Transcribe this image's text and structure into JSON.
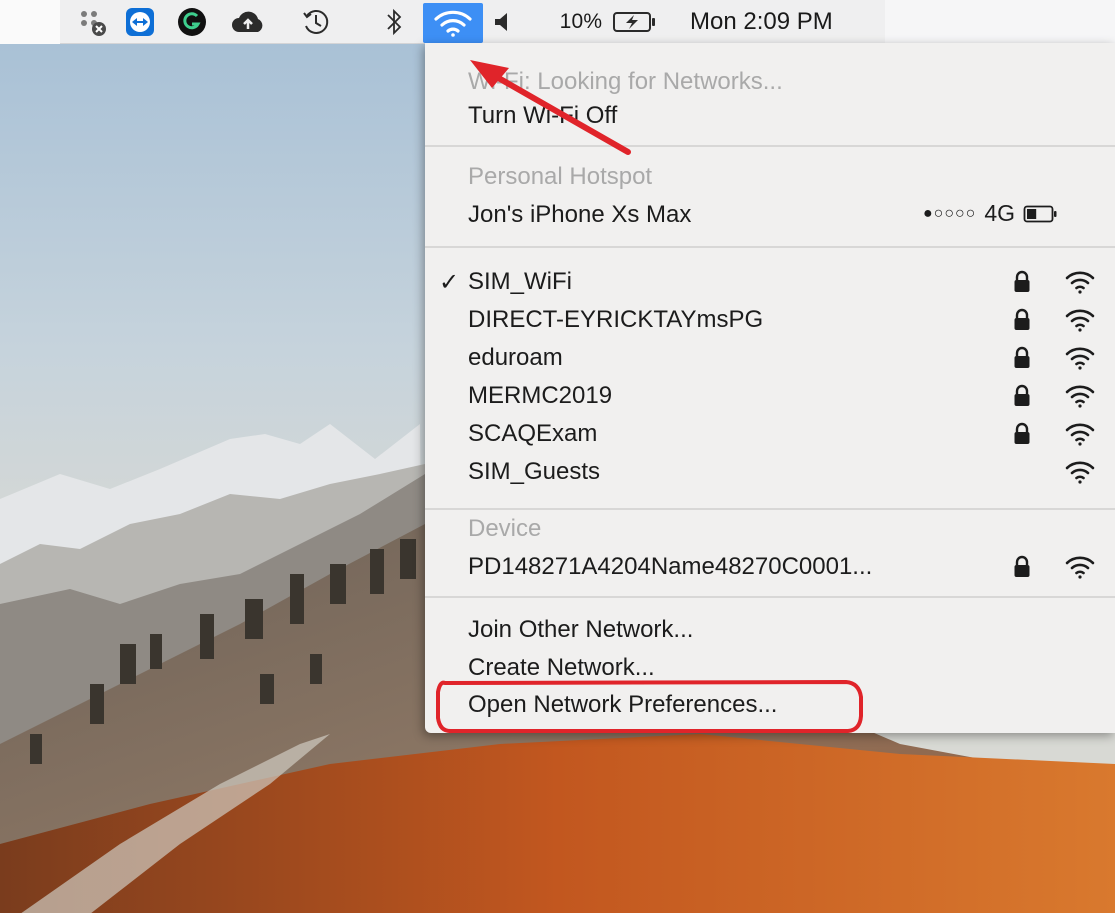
{
  "menubar": {
    "battery_percent": "10%",
    "clock": "Mon 2:09 PM",
    "icons": [
      "extension-icon",
      "teamviewer-icon",
      "grammarly-icon",
      "cloud-upload-icon",
      "time-machine-icon",
      "bluetooth-icon",
      "wifi-icon",
      "volume-icon",
      "battery-charging-icon"
    ],
    "battery_level": 0.1,
    "accent_color": "#3d8ff5"
  },
  "wifi_menu": {
    "status": "Wi-Fi: Looking for Networks...",
    "toggle_label": "Turn Wi-Fi Off",
    "hotspot_section_title": "Personal Hotspot",
    "hotspot": {
      "name": "Jon's iPhone Xs Max",
      "signal_dots": "●○○○○",
      "network_type": "4G",
      "battery_level": 0.4
    },
    "networks": [
      {
        "name": "SIM_WiFi",
        "selected": true,
        "locked": true
      },
      {
        "name": "DIRECT-EYRICKTAYmsPG",
        "selected": false,
        "locked": true
      },
      {
        "name": "eduroam",
        "selected": false,
        "locked": true
      },
      {
        "name": "MERMC2019",
        "selected": false,
        "locked": true
      },
      {
        "name": "SCAQExam",
        "selected": false,
        "locked": true
      },
      {
        "name": "SIM_Guests",
        "selected": false,
        "locked": false
      }
    ],
    "checkmark": "✓",
    "device_section_title": "Device",
    "device": {
      "name": "PD148271A4204Name48270C0001...",
      "locked": true
    },
    "actions": {
      "join_other": "Join Other Network...",
      "create": "Create Network...",
      "open_preferences": "Open Network Preferences..."
    }
  },
  "annotations": {
    "arrow_color": "#e0242a",
    "highlight_color": "#e0242a"
  }
}
